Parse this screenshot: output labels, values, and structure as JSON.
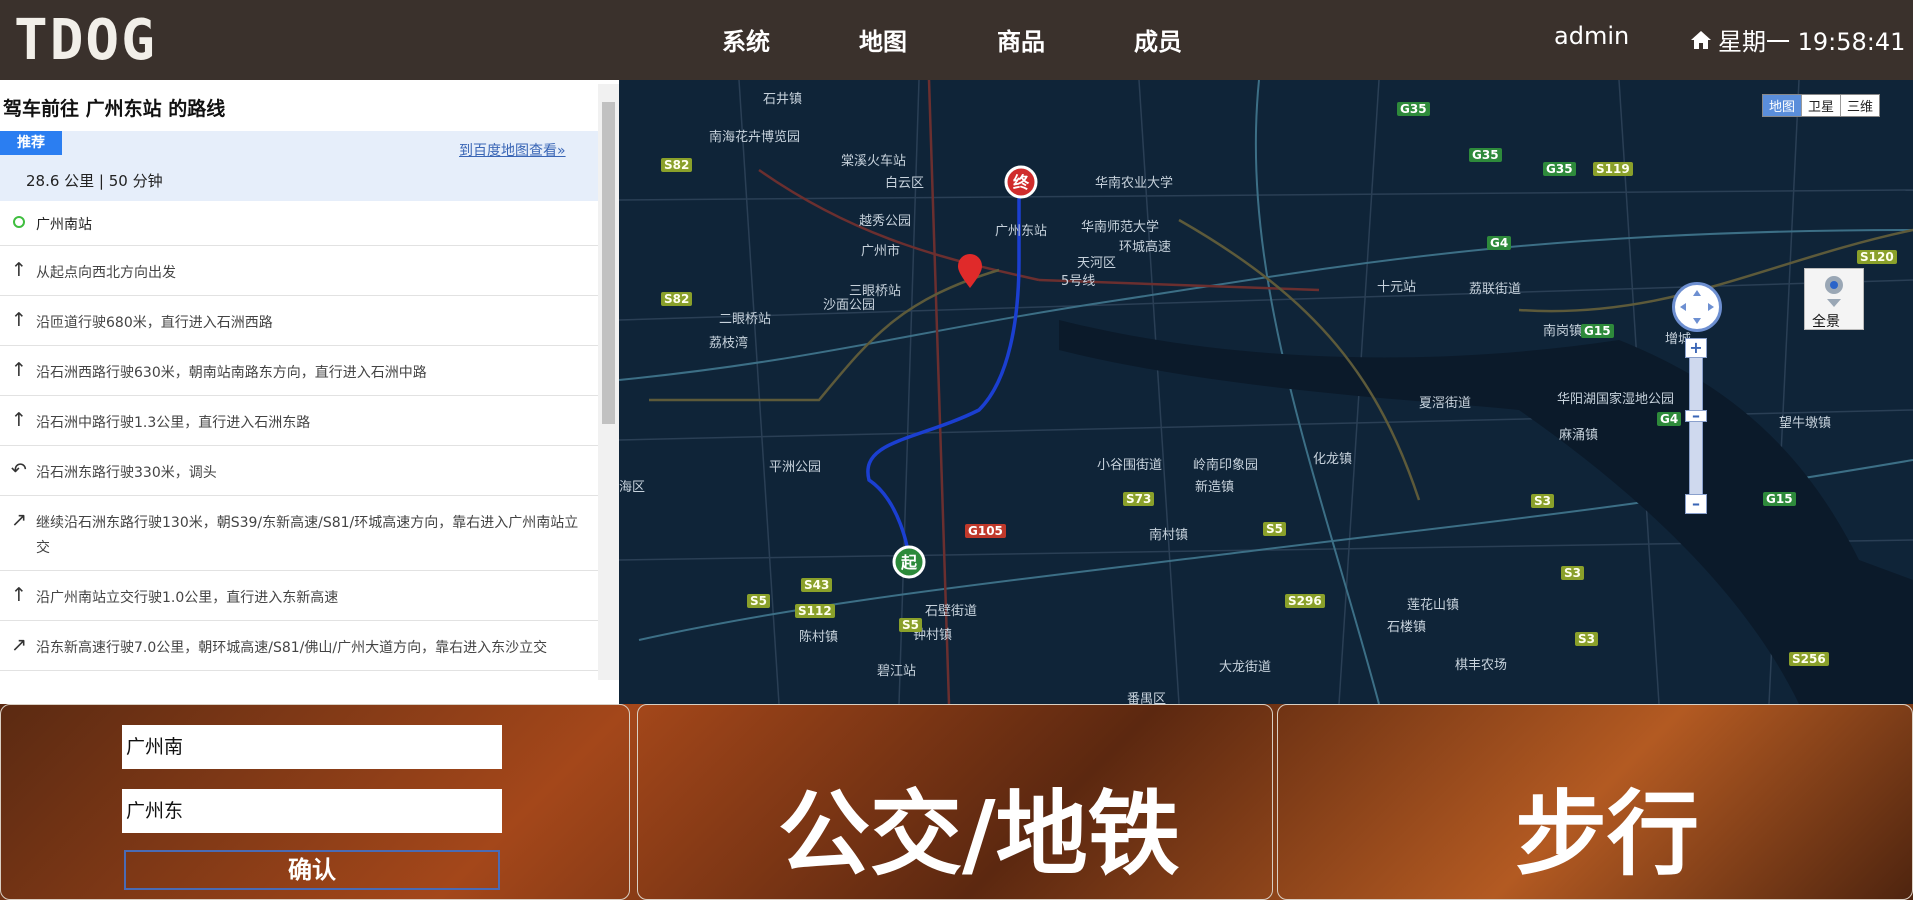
{
  "header": {
    "logo": "TDOG",
    "nav": [
      "系统",
      "地图",
      "商品",
      "成员"
    ],
    "user": "admin",
    "clock": "星期一 19:58:41",
    "home_icon": "home-icon"
  },
  "route_panel": {
    "title": "驾车前往 广州东站 的路线",
    "tag": "推荐",
    "baidu_link": "到百度地图查看»",
    "summary": "28.6 公里 | 50 分钟",
    "start": "广州南站",
    "steps": [
      {
        "icon": "straight-arrow-icon",
        "text": "从起点向西北方向出发"
      },
      {
        "icon": "straight-arrow-icon",
        "text": "沿匝道行驶680米，直行进入石洲西路"
      },
      {
        "icon": "straight-arrow-icon",
        "text": "沿石洲西路行驶630米，朝南站南路东方向，直行进入石洲中路"
      },
      {
        "icon": "straight-arrow-icon",
        "text": "沿石洲中路行驶1.3公里，直行进入石洲东路"
      },
      {
        "icon": "u-turn-icon",
        "text": "沿石洲东路行驶330米，调头"
      },
      {
        "icon": "fork-right-icon",
        "text": "继续沿石洲东路行驶130米，朝S39/东新高速/S81/环城高速方向，靠右进入广州南站立交"
      },
      {
        "icon": "straight-arrow-icon",
        "text": "沿广州南站立交行驶1.0公里，直行进入东新高速"
      },
      {
        "icon": "fork-right-icon",
        "text": "沿东新高速行驶7.0公里，朝环城高速/S81/佛山/广州大道方向，靠右进入东沙立交"
      }
    ]
  },
  "map": {
    "type_tabs": [
      "地图",
      "卫星",
      "三维"
    ],
    "panorama": "全景",
    "start_marker": "起",
    "end_marker": "终",
    "labels": [
      "石井镇",
      "南海花卉博览园",
      "棠溪火车站",
      "白云区",
      "越秀公园",
      "广州市",
      "沙面公园",
      "二眼桥站",
      "荔枝湾",
      "三眼桥站",
      "华南农业大学",
      "华南师范大学",
      "天河区",
      "5号线",
      "广州东站",
      "十元站",
      "荔联街道",
      "南岗镇",
      "增城",
      "夏滘街道",
      "华阳湖国家湿地公园",
      "麻涌镇",
      "望牛墩镇",
      "小谷围街道",
      "岭南印象园",
      "新造镇",
      "化龙镇",
      "南村镇",
      "平洲公园",
      "海区",
      "陈村镇",
      "钟村镇",
      "石壁街道",
      "碧江站",
      "番禺区",
      "大龙街道",
      "莲花山镇",
      "石楼镇",
      "棋丰农场",
      "环城高速"
    ],
    "roads": [
      "S82",
      "S82",
      "G35",
      "G35",
      "G35",
      "S119",
      "G4",
      "S120",
      "G15",
      "G4",
      "S73",
      "S5",
      "G105",
      "S3",
      "S3",
      "S3",
      "G15",
      "S296",
      "S43",
      "S112",
      "S5",
      "S5",
      "S256"
    ]
  },
  "form": {
    "from": "广州南",
    "to": "广州东",
    "confirm": "确认"
  },
  "modes": {
    "bus": "公交/地铁",
    "walk": "步行"
  }
}
